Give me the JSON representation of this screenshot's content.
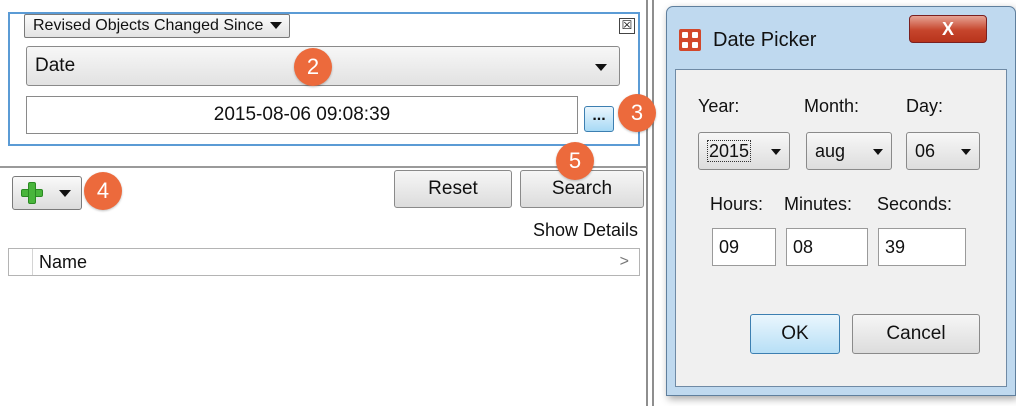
{
  "search_panel": {
    "criteria_select": "Revised Objects Changed Since",
    "close_glyph": "☒",
    "date_type_combo": "Date",
    "date_value": "2015-08-06 09:08:39",
    "ellipsis_label": "...",
    "add_icon": "plus-icon",
    "reset_label": "Reset",
    "search_label": "Search",
    "show_details_label": "Show Details",
    "results_column_name": "Name",
    "results_chevron": ">"
  },
  "callouts": [
    "2",
    "3",
    "4",
    "5"
  ],
  "callout_color": "#ec6a3c",
  "date_picker": {
    "title": "Date Picker",
    "close_glyph": "X",
    "year_label": "Year:",
    "month_label": "Month:",
    "day_label": "Day:",
    "year_value": "2015",
    "month_value": "aug",
    "day_value": "06",
    "hours_label": "Hours:",
    "minutes_label": "Minutes:",
    "seconds_label": "Seconds:",
    "hours_value": "09",
    "minutes_value": "08",
    "seconds_value": "39",
    "ok_label": "OK",
    "cancel_label": "Cancel"
  },
  "colors": {
    "group_border": "#5b9bd5",
    "dialog_frame": "#bfd9ef",
    "close_button": "#c6452c",
    "app_icon": "#d2472b"
  }
}
